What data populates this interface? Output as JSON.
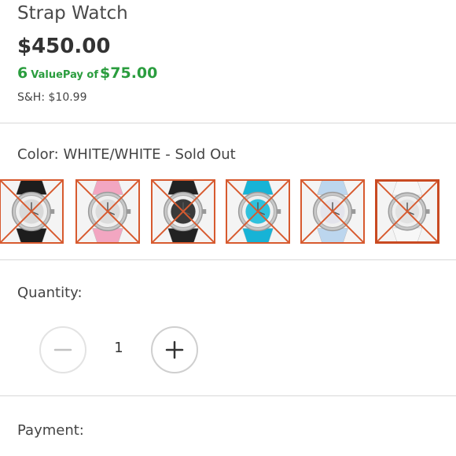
{
  "product": {
    "title": "Strap Watch",
    "price": "$450.00",
    "valuepay_count": "6",
    "valuepay_text": "ValuePay of",
    "valuepay_amount": "$75.00",
    "shipping": "S&H: $10.99"
  },
  "color": {
    "label": "Color: WHITE/WHITE - Sold Out",
    "swatches": [
      {
        "name": "black-silver",
        "strap": "#1d1d1d",
        "dial": "#d9d9d9",
        "sold_out": true,
        "selected": false
      },
      {
        "name": "pink",
        "strap": "#f2a6c1",
        "dial": "#dcdcdc",
        "sold_out": true,
        "selected": false
      },
      {
        "name": "black",
        "strap": "#222222",
        "dial": "#3a3a3a",
        "sold_out": true,
        "selected": false
      },
      {
        "name": "turquoise",
        "strap": "#17b3d6",
        "dial": "#2fc1dd",
        "sold_out": true,
        "selected": false
      },
      {
        "name": "light-blue",
        "strap": "#bcd6ee",
        "dial": "#e4e4ec",
        "sold_out": true,
        "selected": false
      },
      {
        "name": "white",
        "strap": "#f7f7f7",
        "dial": "#e2e2e2",
        "sold_out": true,
        "selected": true
      }
    ],
    "cross_color": "#d75a2f"
  },
  "quantity": {
    "label": "Quantity:",
    "value": "1",
    "minus_icon": "minus-icon",
    "plus_icon": "plus-icon"
  },
  "payment": {
    "label": "Payment:"
  },
  "colors": {
    "accent_green": "#2a9d3e",
    "swatch_border": "#d75a2f"
  }
}
